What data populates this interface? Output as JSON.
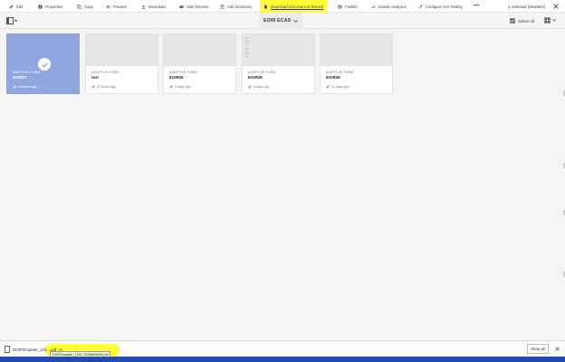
{
  "toolbar": {
    "actions": [
      {
        "label": "Edit",
        "icon": "pencil-icon"
      },
      {
        "label": "Properties",
        "icon": "info-icon"
      },
      {
        "label": "Copy",
        "icon": "copy-icon"
      },
      {
        "label": "Preview",
        "icon": "eye-icon"
      },
      {
        "label": "Download",
        "icon": "download-icon"
      },
      {
        "label": "Start Review",
        "icon": "review-icon"
      },
      {
        "label": "Add Dictionary",
        "icon": "dictionary-icon"
      },
      {
        "label": "Download Document of Record",
        "icon": "document-icon"
      },
      {
        "label": "Publish",
        "icon": "globe-icon"
      },
      {
        "label": "Enable Analytics",
        "icon": "analytics-icon"
      },
      {
        "label": "Configure IUX Testing",
        "icon": "wrench-icon"
      },
      {
        "label": "•••",
        "icon": "more-icon"
      }
    ],
    "selected_info": "1 selected (deselect)"
  },
  "header": {
    "folder_title": "EOIR ECAS",
    "select_all_label": "Select All"
  },
  "cards": [
    {
      "type": "ADAPTIVE FORM",
      "name": "EOIR27",
      "time": "a minute ago",
      "selected": true
    },
    {
      "type": "ADAPTIVE FORM",
      "name": "test",
      "time": "22 hours ago",
      "selected": false
    },
    {
      "type": "ADAPTIVE FORM",
      "name": "EOIR26",
      "time": "5 days ago",
      "selected": false
    },
    {
      "type": "ADAPTIVE FORM",
      "name": "EOIR29",
      "time": "6 days ago",
      "selected": false
    },
    {
      "type": "ADAPTIVE FORM",
      "name": "EOIR28",
      "time": "11 days ago",
      "selected": false
    }
  ],
  "downloads": {
    "file_label": "DORTemplate_133....pdf",
    "tooltip": "DORTemplate_1333 76256906695.pdf",
    "show_all_label": "Show all"
  },
  "colors": {
    "highlight": "#ffff3a",
    "selected_card": "#90a6df",
    "taskbar": "#1f4fb3"
  }
}
